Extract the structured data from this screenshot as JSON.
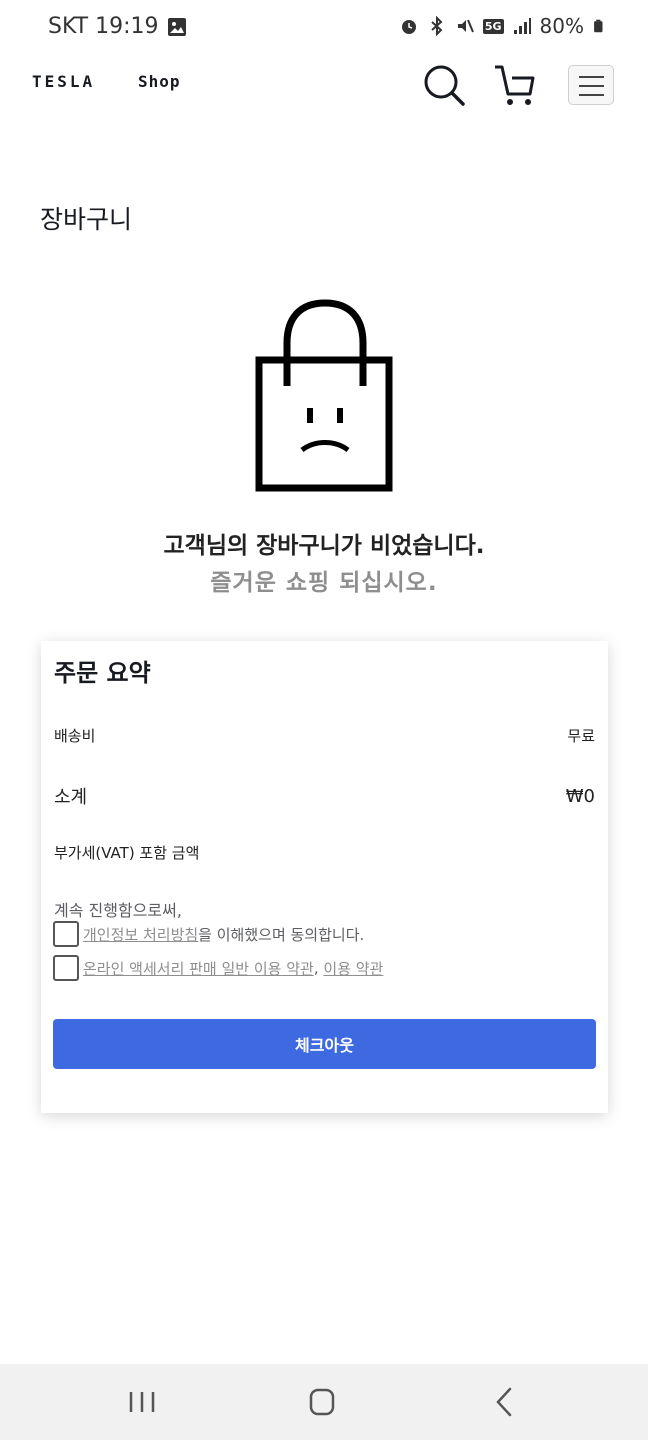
{
  "status_bar": {
    "carrier_time": "SKT 19:19",
    "battery": "80%",
    "network": "5G"
  },
  "nav": {
    "logo": "TESLA",
    "shop": "Shop",
    "search_icon": "search-icon",
    "cart_icon": "cart-icon",
    "menu_icon": "hamburger-menu-icon"
  },
  "page": {
    "title": "장바구니"
  },
  "empty_state": {
    "icon": "sad-bag-icon",
    "title": "고객님의 장바구니가 비었습니다.",
    "subtitle": "즐거운 쇼핑 되십시오."
  },
  "summary": {
    "title": "주문 요약",
    "shipping_label": "배송비",
    "shipping_value": "무료",
    "subtotal_label": "소계",
    "subtotal_value": "₩0",
    "vat_label": "부가세(VAT) 포함 금액",
    "continue_text": "계속 진행함으로써,",
    "privacy_link": "개인정보 처리방침",
    "privacy_suffix": "을 이해했으며 동의합니다.",
    "terms_link_1": "온라인 액세서리 판매 일반 이용 약관",
    "terms_separator": ", ",
    "terms_link_2": "이용 약관",
    "checkout_label": "체크아웃"
  },
  "android_nav": {
    "recents": "recents-icon",
    "home": "home-icon",
    "back": "back-icon"
  },
  "colors": {
    "accent": "#3e6ae1",
    "text": "#171a20",
    "muted": "#8e8e8e"
  }
}
